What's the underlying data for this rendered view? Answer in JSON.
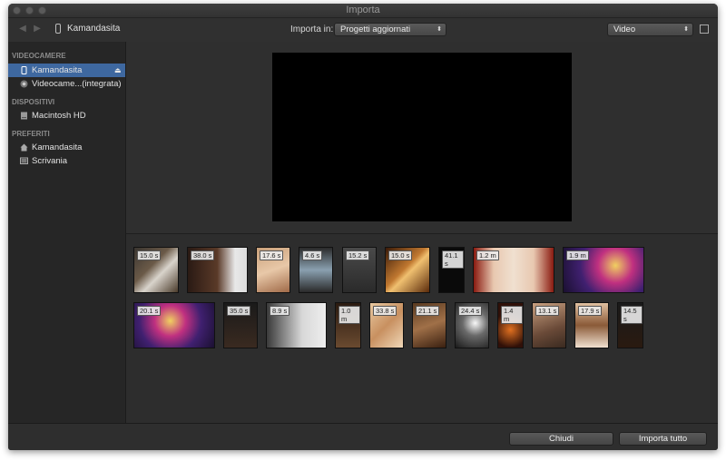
{
  "window": {
    "title": "Importa"
  },
  "toolbar": {
    "device_name": "Kamandasita",
    "import_label": "Importa in:",
    "import_target": "Progetti aggiornati",
    "view_mode": "Video"
  },
  "sidebar": {
    "sections": [
      {
        "title": "VIDEOCAMERE",
        "items": [
          {
            "label": "Kamandasita",
            "icon": "phone-icon",
            "selected": true
          },
          {
            "label": "Videocame...(integrata)",
            "icon": "camera-icon",
            "selected": false
          }
        ]
      },
      {
        "title": "DISPOSITIVI",
        "items": [
          {
            "label": "Macintosh HD",
            "icon": "hard-drive-icon",
            "selected": false
          }
        ]
      },
      {
        "title": "PREFERITI",
        "items": [
          {
            "label": "Kamandasita",
            "icon": "home-icon",
            "selected": false
          },
          {
            "label": "Scrivania",
            "icon": "desktop-icon",
            "selected": false
          }
        ]
      }
    ]
  },
  "clips": [
    {
      "duration": "15.0 s"
    },
    {
      "duration": "38.0 s"
    },
    {
      "duration": "17.6 s"
    },
    {
      "duration": "4.6 s"
    },
    {
      "duration": "15.2 s"
    },
    {
      "duration": "15.0 s"
    },
    {
      "duration": "41.1 s"
    },
    {
      "duration": "1.2 m"
    },
    {
      "duration": "1.9 m"
    },
    {
      "duration": "20.1 s"
    },
    {
      "duration": "35.0 s"
    },
    {
      "duration": "8.9 s"
    },
    {
      "duration": "1.0 m"
    },
    {
      "duration": "33.8 s"
    },
    {
      "duration": "21.1 s"
    },
    {
      "duration": "24.4 s"
    },
    {
      "duration": "1.4 m"
    },
    {
      "duration": "13.1 s"
    },
    {
      "duration": "17.9 s"
    },
    {
      "duration": "14.5 s"
    }
  ],
  "footer": {
    "close_label": "Chiudi",
    "import_all_label": "Importa tutto"
  }
}
